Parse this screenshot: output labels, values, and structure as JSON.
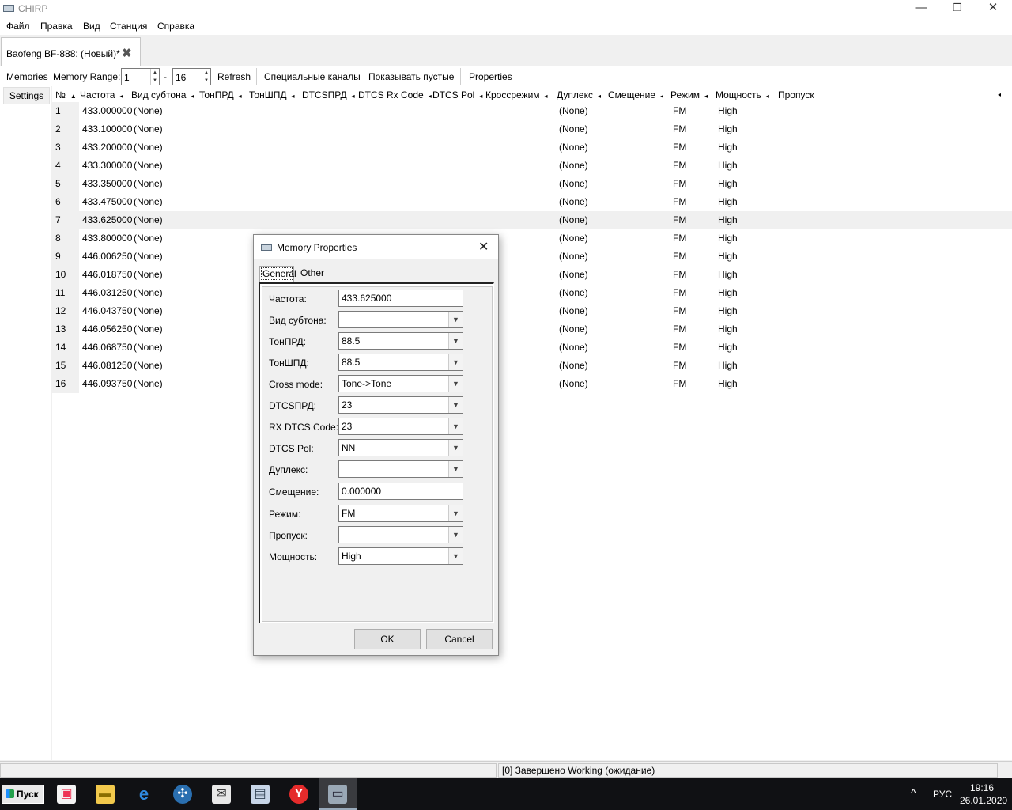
{
  "window": {
    "title": "CHIRP",
    "minimize": "—",
    "restore": "❐",
    "close": "✕"
  },
  "menu": [
    "Файл",
    "Правка",
    "Вид",
    "Станция",
    "Справка"
  ],
  "doc_tab": {
    "label": "Baofeng BF-888: (Новый)*",
    "close": "✖"
  },
  "toolbar": {
    "memories": "Memories",
    "memory_range": "Memory Range:",
    "range_from": "1",
    "range_sep": "-",
    "range_to": "16",
    "refresh": "Refresh",
    "special_channels": "Специальные каналы",
    "show_empty": "Показывать пустые",
    "properties": "Properties"
  },
  "settings_label": "Settings",
  "columns": [
    "№",
    "Частота",
    "Вид субтона",
    "ТонПРД",
    "ТонШПД",
    "DTCSПРД",
    "DTCS Rx Code",
    "DTCS Pol",
    "Кроссрежим",
    "Дуплекс",
    "Смещение",
    "Режим",
    "Мощность",
    "Пропуск"
  ],
  "sort_arrow": "▲",
  "col_arrow": "◂",
  "rows": [
    {
      "num": "1",
      "freq": "433.000000",
      "tone": "(None)",
      "duplex": "(None)",
      "mode": "FM",
      "power": "High"
    },
    {
      "num": "2",
      "freq": "433.100000",
      "tone": "(None)",
      "duplex": "(None)",
      "mode": "FM",
      "power": "High"
    },
    {
      "num": "3",
      "freq": "433.200000",
      "tone": "(None)",
      "duplex": "(None)",
      "mode": "FM",
      "power": "High"
    },
    {
      "num": "4",
      "freq": "433.300000",
      "tone": "(None)",
      "duplex": "(None)",
      "mode": "FM",
      "power": "High"
    },
    {
      "num": "5",
      "freq": "433.350000",
      "tone": "(None)",
      "duplex": "(None)",
      "mode": "FM",
      "power": "High"
    },
    {
      "num": "6",
      "freq": "433.475000",
      "tone": "(None)",
      "duplex": "(None)",
      "mode": "FM",
      "power": "High"
    },
    {
      "num": "7",
      "freq": "433.625000",
      "tone": "(None)",
      "duplex": "(None)",
      "mode": "FM",
      "power": "High"
    },
    {
      "num": "8",
      "freq": "433.800000",
      "tone": "(None)",
      "duplex": "(None)",
      "mode": "FM",
      "power": "High"
    },
    {
      "num": "9",
      "freq": "446.006250",
      "tone": "(None)",
      "duplex": "(None)",
      "mode": "FM",
      "power": "High"
    },
    {
      "num": "10",
      "freq": "446.018750",
      "tone": "(None)",
      "duplex": "(None)",
      "mode": "FM",
      "power": "High"
    },
    {
      "num": "11",
      "freq": "446.031250",
      "tone": "(None)",
      "duplex": "(None)",
      "mode": "FM",
      "power": "High"
    },
    {
      "num": "12",
      "freq": "446.043750",
      "tone": "(None)",
      "duplex": "(None)",
      "mode": "FM",
      "power": "High"
    },
    {
      "num": "13",
      "freq": "446.056250",
      "tone": "(None)",
      "duplex": "(None)",
      "mode": "FM",
      "power": "High"
    },
    {
      "num": "14",
      "freq": "446.068750",
      "tone": "(None)",
      "duplex": "(None)",
      "mode": "FM",
      "power": "High"
    },
    {
      "num": "15",
      "freq": "446.081250",
      "tone": "(None)",
      "duplex": "(None)",
      "mode": "FM",
      "power": "High"
    },
    {
      "num": "16",
      "freq": "446.093750",
      "tone": "(None)",
      "duplex": "(None)",
      "mode": "FM",
      "power": "High"
    }
  ],
  "selected_row": "7",
  "dialog": {
    "title": "Memory Properties",
    "close": "✕",
    "tabs": [
      "General",
      "Other"
    ],
    "fields": [
      {
        "label": "Частота:",
        "type": "text",
        "value": "433.625000"
      },
      {
        "label": "Вид субтона:",
        "type": "combo",
        "value": ""
      },
      {
        "label": "ТонПРД:",
        "type": "combo",
        "value": "88.5"
      },
      {
        "label": "ТонШПД:",
        "type": "combo",
        "value": "88.5"
      },
      {
        "label": "Cross mode:",
        "type": "combo",
        "value": "Tone->Tone"
      },
      {
        "label": "DTCSПРД:",
        "type": "combo",
        "value": "23"
      },
      {
        "label": "RX DTCS Code:",
        "type": "combo",
        "value": "23"
      },
      {
        "label": "DTCS Pol:",
        "type": "combo",
        "value": "NN"
      },
      {
        "label": "Дуплекс:",
        "type": "combo",
        "value": ""
      },
      {
        "label": "Смещение:",
        "type": "text",
        "value": "0.000000"
      },
      {
        "label": "Режим:",
        "type": "combo",
        "value": "FM"
      },
      {
        "label": "Пропуск:",
        "type": "combo",
        "value": ""
      },
      {
        "label": "Мощность:",
        "type": "combo",
        "value": "High"
      }
    ],
    "ok": "OK",
    "cancel": "Cancel"
  },
  "status": {
    "text": "[0] Завершено Working (ожидание)"
  },
  "taskbar": {
    "start": "Пуск",
    "apps": [
      "store-icon",
      "file-explorer-icon",
      "edge-icon",
      "network-app-icon",
      "mail-icon",
      "computer-icon",
      "yandex-browser-icon",
      "chirp-icon"
    ],
    "tray_up": "^",
    "lang": "РУС",
    "time": "19:16",
    "date": "26.01.2020"
  }
}
